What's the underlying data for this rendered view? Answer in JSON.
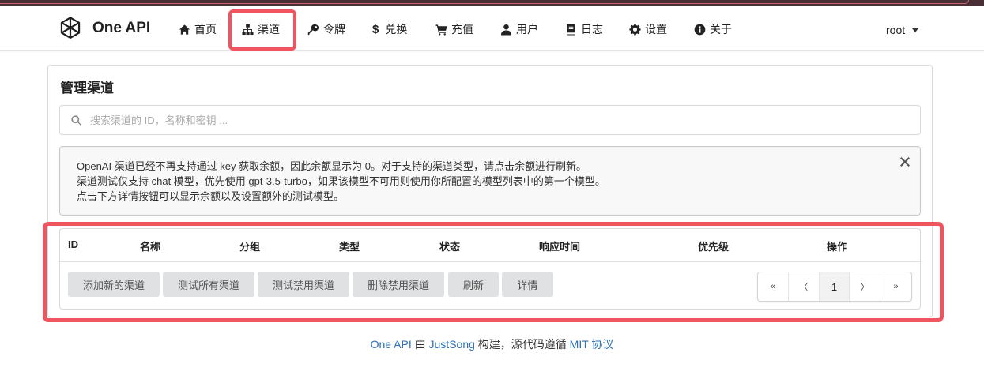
{
  "brand": {
    "name": "One API",
    "logo": "openai-logo-icon"
  },
  "nav": {
    "items": [
      {
        "label": "首页",
        "icon": "home-icon"
      },
      {
        "label": "渠道",
        "icon": "sitemap-icon"
      },
      {
        "label": "令牌",
        "icon": "key-icon"
      },
      {
        "label": "兑换",
        "icon": "dollar-icon"
      },
      {
        "label": "充值",
        "icon": "cart-icon"
      },
      {
        "label": "用户",
        "icon": "user-icon"
      },
      {
        "label": "日志",
        "icon": "book-icon"
      },
      {
        "label": "设置",
        "icon": "gear-icon"
      },
      {
        "label": "关于",
        "icon": "info-icon"
      }
    ],
    "user": "root"
  },
  "page": {
    "title": "管理渠道",
    "search_placeholder": "搜索渠道的 ID，名称和密钥 ...",
    "notice": [
      "OpenAI 渠道已经不再支持通过 key 获取余额，因此余额显示为 0。对于支持的渠道类型，请点击余额进行刷新。",
      "渠道测试仅支持 chat 模型，优先使用 gpt-3.5-turbo，如果该模型不可用则使用你所配置的模型列表中的第一个模型。",
      "点击下方详情按钮可以显示余额以及设置额外的测试模型。"
    ],
    "table": {
      "headers": [
        "ID",
        "名称",
        "分组",
        "类型",
        "状态",
        "响应时间",
        "优先级",
        "操作"
      ]
    },
    "actions": [
      "添加新的渠道",
      "测试所有渠道",
      "测试禁用渠道",
      "删除禁用渠道",
      "刷新",
      "详情"
    ],
    "pagination": {
      "first": "«",
      "prev": "〈",
      "current": "1",
      "next": "〉",
      "last": "»"
    }
  },
  "footer": {
    "app_link": "One API",
    "by": "由",
    "author_link": "JustSong",
    "built": "构建，源代码遵循",
    "license_link": "MIT 协议"
  },
  "colors": {
    "highlight": "#f0555f",
    "link": "#2e6fb5",
    "button_bg": "#e0e1e2"
  }
}
